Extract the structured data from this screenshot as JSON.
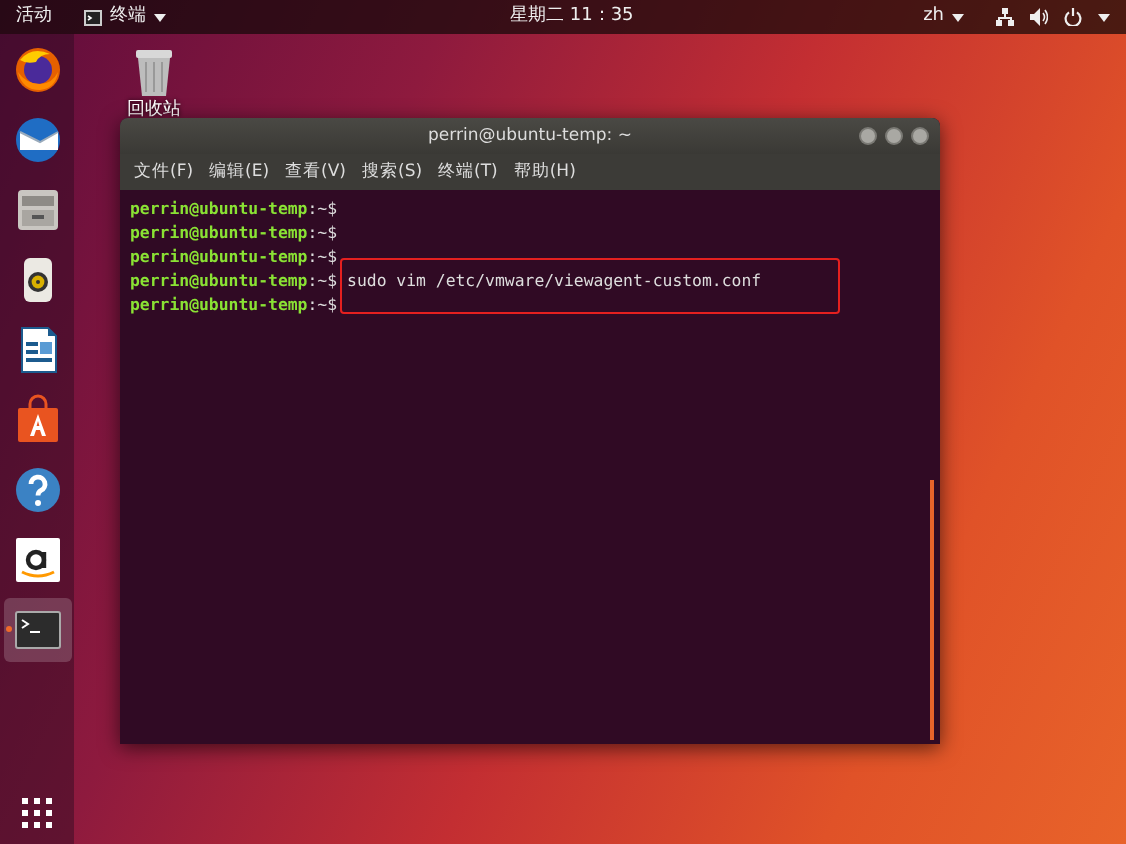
{
  "top_bar": {
    "activities": "活动",
    "app_menu": "终端",
    "clock": "星期二 11：35",
    "input_method": "zh"
  },
  "dock": {
    "items": [
      {
        "kind": "firefox",
        "selected": false,
        "running": false
      },
      {
        "kind": "mail",
        "selected": false,
        "running": false
      },
      {
        "kind": "files",
        "selected": false,
        "running": false
      },
      {
        "kind": "music",
        "selected": false,
        "running": false
      },
      {
        "kind": "writer",
        "selected": false,
        "running": false
      },
      {
        "kind": "software",
        "selected": false,
        "running": false
      },
      {
        "kind": "help",
        "selected": false,
        "running": false
      },
      {
        "kind": "amazon",
        "selected": false,
        "running": false
      },
      {
        "kind": "terminal",
        "selected": true,
        "running": true
      }
    ]
  },
  "desktop_icons": [
    {
      "kind": "trash",
      "label": "回收站"
    }
  ],
  "terminal": {
    "title": "perrin@ubuntu-temp: ~",
    "menu": [
      "文件(F)",
      "编辑(E)",
      "查看(V)",
      "搜索(S)",
      "终端(T)",
      "帮助(H)"
    ],
    "lines": [
      {
        "prompt": "perrin@ubuntu-temp",
        "suffix": ":~$",
        "highlighted": false
      },
      {
        "prompt": "perrin@ubuntu-temp",
        "suffix": ":~$",
        "highlighted": false
      },
      {
        "prompt": "perrin@ubuntu-temp",
        "suffix": ":~$",
        "highlighted": false
      },
      {
        "prompt": "perrin@ubuntu-temp",
        "suffix": ":~$",
        "command": "sudo vim /etc/vmware/viewagent-custom.conf",
        "highlighted": true
      },
      {
        "prompt": "perrin@ubuntu-temp",
        "suffix": ":~$",
        "highlighted": false
      }
    ]
  }
}
